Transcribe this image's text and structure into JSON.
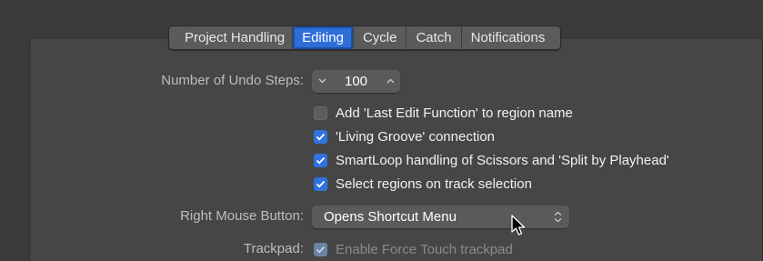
{
  "tabs": [
    {
      "label": "Project Handling",
      "active": false
    },
    {
      "label": "Editing",
      "active": true
    },
    {
      "label": "Cycle",
      "active": false
    },
    {
      "label": "Catch",
      "active": false
    },
    {
      "label": "Notifications",
      "active": false
    }
  ],
  "undo_steps": {
    "label": "Number of Undo Steps:",
    "value": "100",
    "decrement_icon": "chevron-down-icon",
    "increment_icon": "chevron-up-icon"
  },
  "checkboxes": [
    {
      "label": "Add 'Last Edit Function' to region name",
      "checked": false
    },
    {
      "label": "'Living Groove' connection",
      "checked": true
    },
    {
      "label": "SmartLoop handling of Scissors and 'Split by Playhead'",
      "checked": true
    },
    {
      "label": "Select regions on track selection",
      "checked": true
    }
  ],
  "right_mouse_button": {
    "label": "Right Mouse Button:",
    "value": "Opens Shortcut Menu",
    "icon": "up-down-chevron-icon"
  },
  "trackpad": {
    "label": "Trackpad:",
    "option_label": "Enable Force Touch trackpad",
    "checked": true,
    "enabled": false
  },
  "colors": {
    "accent": "#2e6ed8",
    "background": "#464646",
    "checkbox_on": "#2f72e0"
  }
}
